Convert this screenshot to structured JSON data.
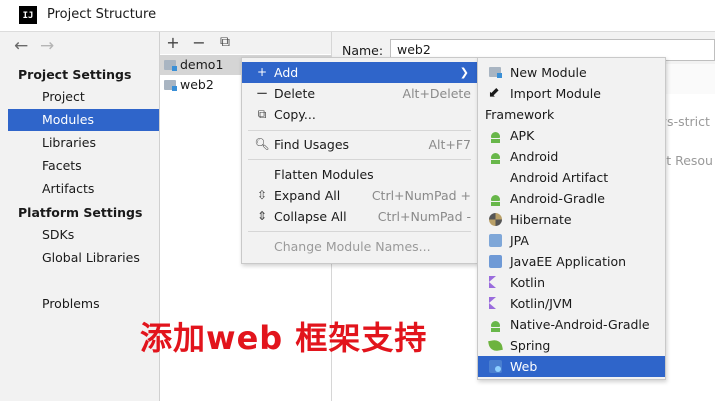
{
  "window": {
    "title": "Project Structure",
    "logo_text": "IJ"
  },
  "nav": {
    "back_glyph": "←",
    "forward_glyph": "→",
    "project_settings_header": "Project Settings",
    "project_settings": [
      "Project",
      "Modules",
      "Libraries",
      "Facets",
      "Artifacts"
    ],
    "platform_settings_header": "Platform Settings",
    "platform_settings": [
      "SDKs",
      "Global Libraries"
    ],
    "problems": "Problems",
    "selected": "Modules"
  },
  "tree_toolbar": {
    "add_glyph": "+",
    "remove_glyph": "−",
    "copy_glyph": "⧉"
  },
  "modules": [
    "demo1",
    "web2"
  ],
  "detail": {
    "name_label": "Name:",
    "name_value": "web2",
    "partial_tag": "ays-strict",
    "partial_resources": "est Resou"
  },
  "context_menu": {
    "add": "Add",
    "delete": "Delete",
    "delete_shortcut": "Alt+Delete",
    "copy": "Copy...",
    "find_usages": "Find Usages",
    "find_usages_shortcut": "Alt+F7",
    "flatten_modules": "Flatten Modules",
    "expand_all": "Expand All",
    "expand_all_shortcut": "Ctrl+NumPad +",
    "collapse_all": "Collapse All",
    "collapse_all_shortcut": "Ctrl+NumPad -",
    "change_module_names": "Change Module Names..."
  },
  "submenu": {
    "new_module": "New Module",
    "import_module": "Import Module",
    "framework_header": "Framework",
    "frameworks": [
      "APK",
      "Android",
      "Android Artifact",
      "Android-Gradle",
      "Hibernate",
      "JPA",
      "JavaEE Application",
      "Kotlin",
      "Kotlin/JVM",
      "Native-Android-Gradle",
      "Spring",
      "Web"
    ],
    "selected": "Web"
  },
  "annotation": "添加web 框架支持",
  "colors": {
    "selection": "#2f65ca",
    "annotation_red": "#e2141c",
    "android_green": "#68b74a",
    "kotlin_purple": "#9a6cdd"
  }
}
